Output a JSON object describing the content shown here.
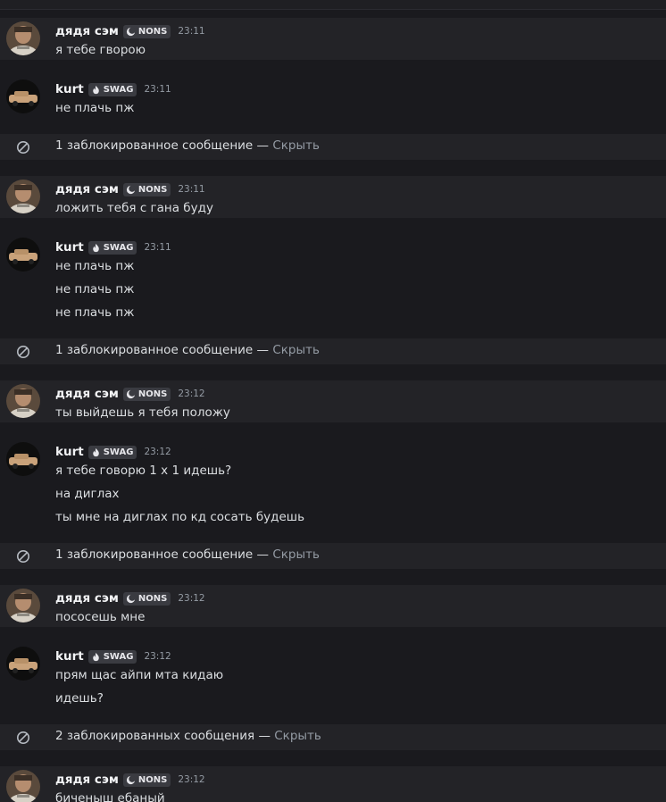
{
  "tags": {
    "nons": {
      "label": "NONS",
      "icon": "moon-icon"
    },
    "swag": {
      "label": "SWAG",
      "icon": "flame-icon"
    }
  },
  "users": {
    "sam": {
      "name": "дядя сэм",
      "tag": "NONS"
    },
    "kurt": {
      "name": "kurt",
      "tag": "SWAG"
    }
  },
  "messages": [
    {
      "user": "дядя сэм",
      "tag": "NONS",
      "time": "23:11",
      "lines": [
        "я тебе гворою"
      ]
    },
    {
      "user": "kurt",
      "tag": "SWAG",
      "time": "23:11",
      "lines": [
        "не плачь пж"
      ]
    },
    {
      "blocked": "1 заблокированное сообщение",
      "hide": "Скрыть"
    },
    {
      "user": "дядя сэм",
      "tag": "NONS",
      "time": "23:11",
      "lines": [
        "ложить тебя с гана буду"
      ]
    },
    {
      "user": "kurt",
      "tag": "SWAG",
      "time": "23:11",
      "lines": [
        "не плачь пж",
        "не плачь пж",
        "не плачь пж"
      ]
    },
    {
      "blocked": "1 заблокированное сообщение",
      "hide": "Скрыть"
    },
    {
      "user": "дядя сэм",
      "tag": "NONS",
      "time": "23:12",
      "lines": [
        "ты выйдешь я тебя положу"
      ]
    },
    {
      "user": "kurt",
      "tag": "SWAG",
      "time": "23:12",
      "lines": [
        "я тебе говорю 1 х 1 идешь?",
        "на диглах",
        "ты мне на диглах по кд сосать будешь"
      ]
    },
    {
      "blocked": "1 заблокированное сообщение",
      "hide": "Скрыть"
    },
    {
      "user": "дядя сэм",
      "tag": "NONS",
      "time": "23:12",
      "lines": [
        "пососешь мне"
      ]
    },
    {
      "user": "kurt",
      "tag": "SWAG",
      "time": "23:12",
      "lines": [
        "прям щас айпи мта кидаю",
        "идешь?"
      ]
    },
    {
      "blocked": "2 заблокированных сообщения",
      "hide": "Скрыть"
    },
    {
      "user": "дядя сэм",
      "tag": "NONS",
      "time": "23:12",
      "lines": [
        "биченыш ебаный"
      ]
    }
  ],
  "separator": "—",
  "colors": {
    "background": "#1a1a1e",
    "highlight": "#232327",
    "username": "#f2f3f5",
    "text": "#dbdee1",
    "muted": "#949ba4",
    "tag_bg": "#3a3b41"
  }
}
